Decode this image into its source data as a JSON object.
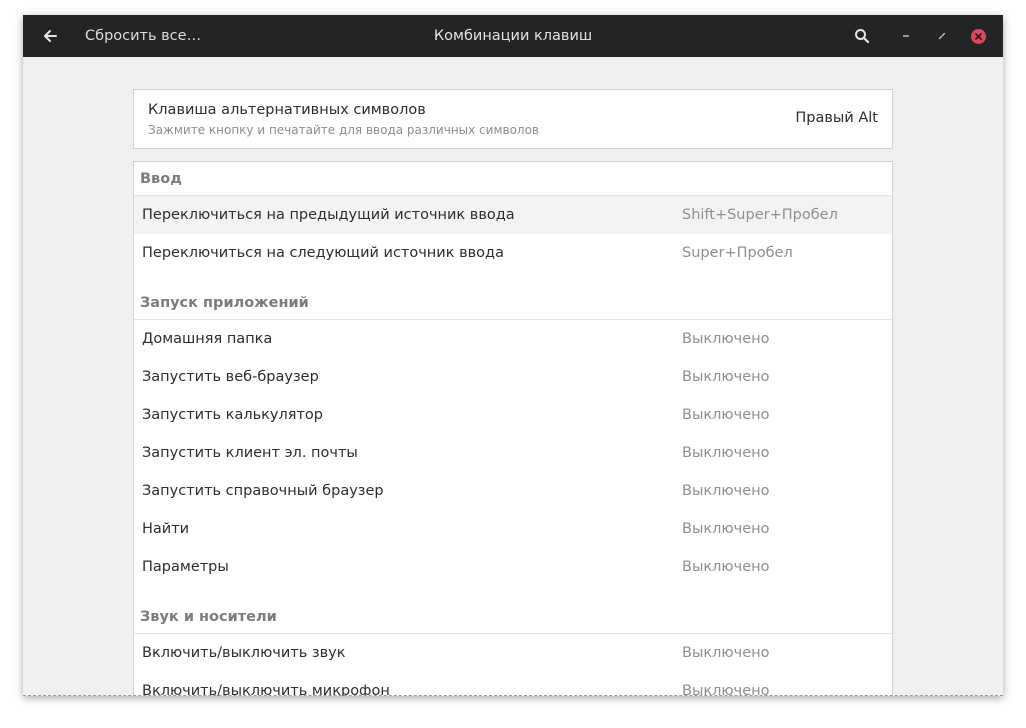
{
  "titlebar": {
    "back_icon": "arrow-left-icon",
    "reset_label": "Сбросить все…",
    "title": "Комбинации клавиш",
    "search_icon": "search-icon",
    "minimize_icon": "minimize-icon",
    "maximize_icon": "maximize-icon",
    "close_icon": "close-icon",
    "close_color": "#e0475a"
  },
  "alternate_key": {
    "title": "Клавиша альтернативных символов",
    "subtitle": "Зажмите кнопку и печатайте для ввода различных символов",
    "value": "Правый Alt"
  },
  "sections": [
    {
      "title": "Ввод",
      "rows": [
        {
          "name": "Переключиться на предыдущий источник ввода",
          "accel": "Shift+Super+Пробел"
        },
        {
          "name": "Переключиться на следующий источник ввода",
          "accel": "Super+Пробел"
        }
      ]
    },
    {
      "title": "Запуск приложений",
      "rows": [
        {
          "name": "Домашняя папка",
          "accel": "Выключено"
        },
        {
          "name": "Запустить веб-браузер",
          "accel": "Выключено"
        },
        {
          "name": "Запустить калькулятор",
          "accel": "Выключено"
        },
        {
          "name": "Запустить клиент эл. почты",
          "accel": "Выключено"
        },
        {
          "name": "Запустить справочный браузер",
          "accel": "Выключено"
        },
        {
          "name": "Найти",
          "accel": "Выключено"
        },
        {
          "name": "Параметры",
          "accel": "Выключено"
        }
      ]
    },
    {
      "title": "Звук и носители",
      "rows": [
        {
          "name": "Включить/выключить звук",
          "accel": "Выключено"
        },
        {
          "name": "Включить/выключить микрофон",
          "accel": "Выключено"
        }
      ]
    }
  ]
}
